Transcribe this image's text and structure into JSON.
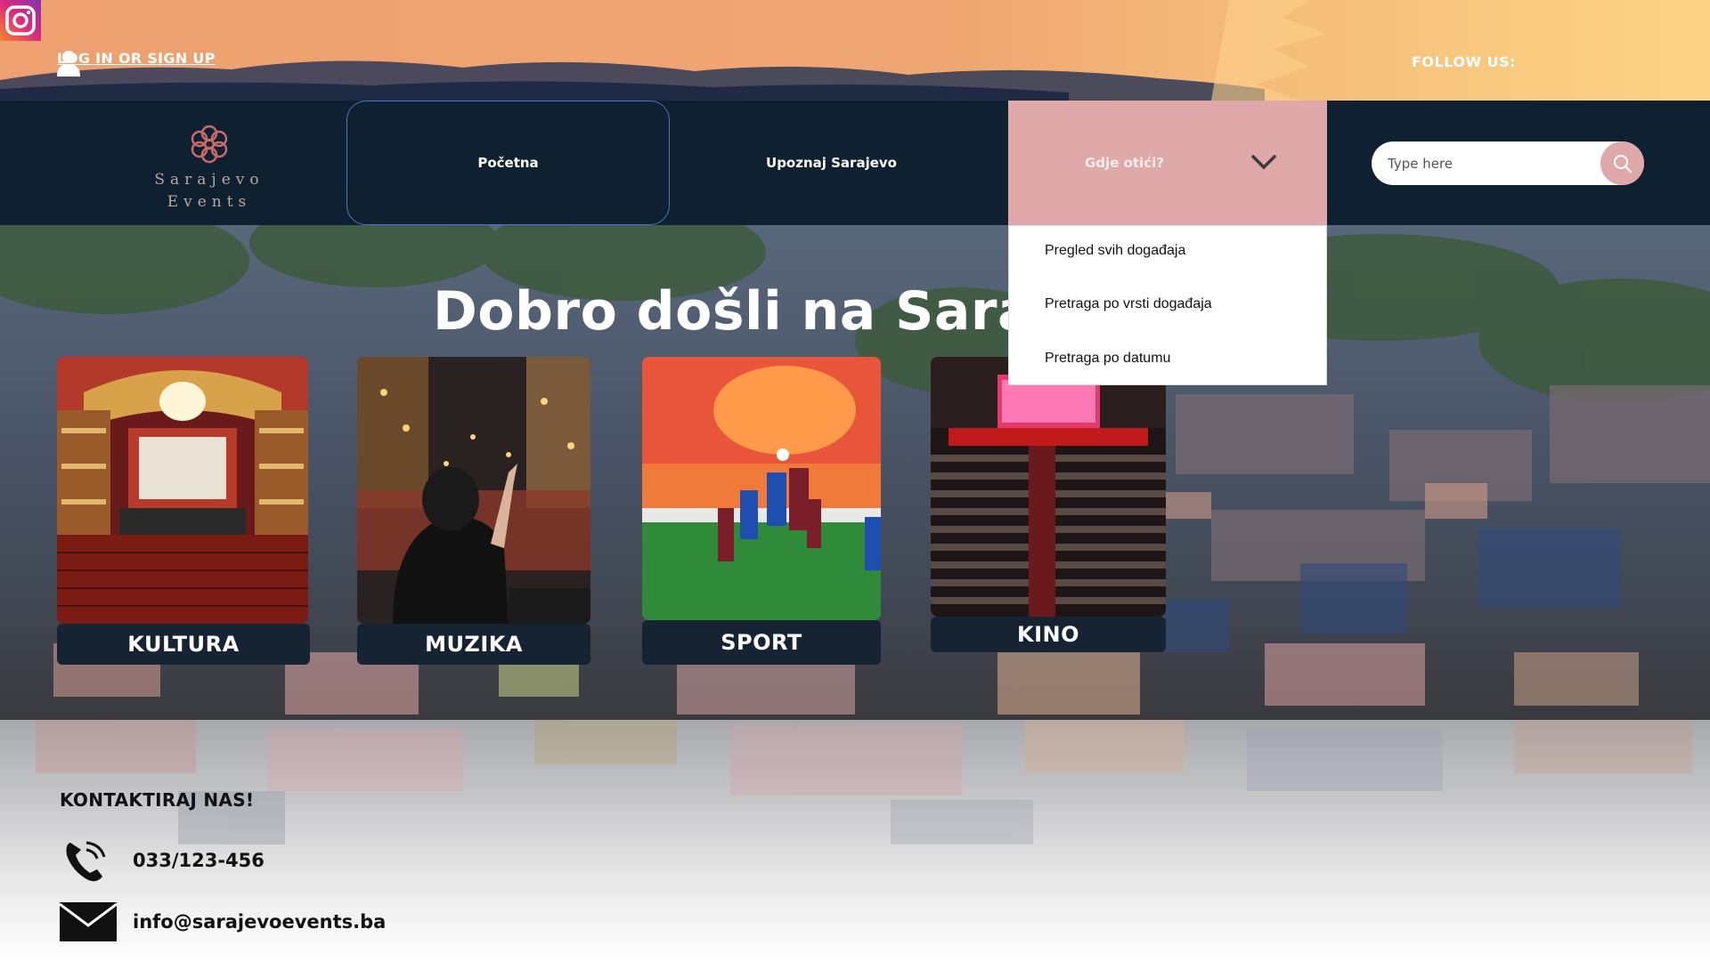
{
  "top_bar": {
    "login_label": "LOG IN OR SIGN UP",
    "follow_label": "FOLLOW US:",
    "social": [
      {
        "name": "facebook-icon",
        "color": "#3b5998"
      },
      {
        "name": "instagram-icon",
        "color": "#e1306c"
      }
    ]
  },
  "brand": {
    "line1": "Sarajevo",
    "line2": "Events",
    "color": "#c96a6a"
  },
  "nav": {
    "items": [
      {
        "label": "Početna"
      },
      {
        "label": "Upoznaj Sarajevo"
      },
      {
        "label": "Gdje otići?"
      }
    ],
    "search_placeholder": "Type here"
  },
  "dropdown": {
    "items": [
      {
        "label": "Pregled svih događaja"
      },
      {
        "label": "Pretraga po vrsti događaja"
      },
      {
        "label": "Pretraga po datumu"
      }
    ]
  },
  "hero": {
    "title": "Dobro došli na Saraje"
  },
  "categories": [
    {
      "label": "KULTURA"
    },
    {
      "label": "MUZIKA"
    },
    {
      "label": "SPORT"
    },
    {
      "label": "KINO"
    }
  ],
  "footer": {
    "contact_title": "KONTAKTIRAJ NAS!",
    "phone": "033/123-456",
    "email": "info@sarajevoevents.ba"
  },
  "colors": {
    "nav_bg": "#0f2130",
    "accent_pink": "#e0a9a9",
    "active_border": "#4a73c9"
  }
}
